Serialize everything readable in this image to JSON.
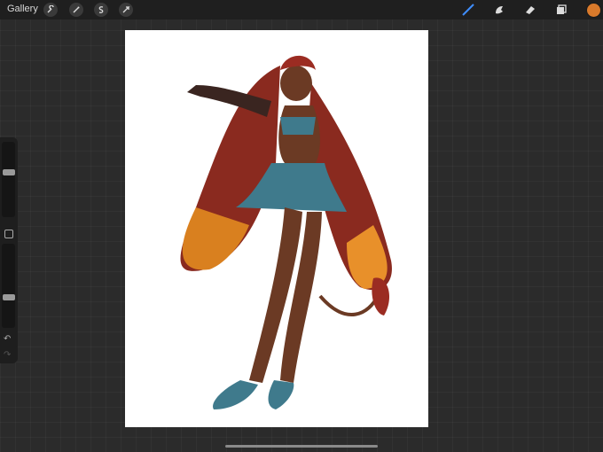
{
  "topbar": {
    "gallery_label": "Gallery",
    "left_tools": [
      "wrench-icon",
      "magic-wand-icon",
      "selection-icon",
      "transform-arrow-icon"
    ],
    "right_tools": [
      "brush-icon",
      "smudge-icon",
      "eraser-icon",
      "layers-icon"
    ],
    "active_tool": "brush-icon",
    "current_color": "#d97a2b"
  },
  "sidebar": {
    "brush_size_level": 0.6,
    "opacity_level": 0.35
  },
  "canvas": {
    "background": "#ffffff"
  }
}
